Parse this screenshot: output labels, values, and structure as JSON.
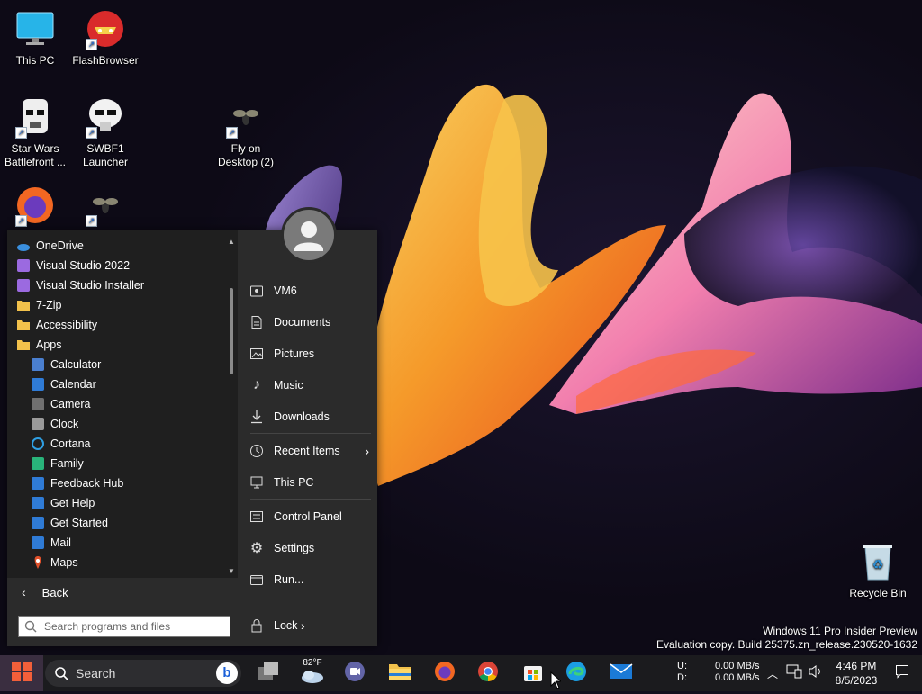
{
  "desktop": {
    "icons": [
      {
        "label": "This PC",
        "icon": "monitor-icon"
      },
      {
        "label": "FlashBrowser",
        "icon": "flash-icon"
      },
      {
        "label": "Star Wars Battlefront ...",
        "icon": "stormtrooper-icon"
      },
      {
        "label": "SWBF1 Launcher",
        "icon": "stormtrooper-icon"
      },
      {
        "label": "Fly on Desktop (2)",
        "icon": "fly-icon"
      },
      {
        "label": "Recycle Bin",
        "icon": "recycle-bin-icon"
      }
    ],
    "watermark": {
      "line1": "Windows 11 Pro Insider Preview",
      "line2": "Evaluation copy. Build 25375.zn_release.230520-1632"
    }
  },
  "start_menu": {
    "programs": [
      {
        "label": "OneDrive",
        "icon": "onedrive-icon",
        "indent": 0
      },
      {
        "label": "Visual Studio 2022",
        "icon": "visual-studio-icon",
        "indent": 0
      },
      {
        "label": "Visual Studio Installer",
        "icon": "visual-studio-icon",
        "indent": 0
      },
      {
        "label": "7-Zip",
        "icon": "folder-icon",
        "indent": 0
      },
      {
        "label": "Accessibility",
        "icon": "folder-icon",
        "indent": 0
      },
      {
        "label": "Apps",
        "icon": "folder-icon",
        "indent": 0
      },
      {
        "label": "Calculator",
        "icon": "calculator-icon",
        "indent": 1
      },
      {
        "label": "Calendar",
        "icon": "calendar-icon",
        "indent": 1
      },
      {
        "label": "Camera",
        "icon": "camera-icon",
        "indent": 1
      },
      {
        "label": "Clock",
        "icon": "clock-icon",
        "indent": 1
      },
      {
        "label": "Cortana",
        "icon": "cortana-icon",
        "indent": 1
      },
      {
        "label": "Family",
        "icon": "family-icon",
        "indent": 1
      },
      {
        "label": "Feedback Hub",
        "icon": "feedback-icon",
        "indent": 1
      },
      {
        "label": "Get Help",
        "icon": "help-icon",
        "indent": 1
      },
      {
        "label": "Get Started",
        "icon": "get-started-icon",
        "indent": 1
      },
      {
        "label": "Mail",
        "icon": "mail-icon",
        "indent": 1
      },
      {
        "label": "Maps",
        "icon": "maps-icon",
        "indent": 1
      }
    ],
    "back_label": "Back",
    "search_placeholder": "Search programs and files",
    "places": {
      "user": "VM6",
      "documents": "Documents",
      "pictures": "Pictures",
      "music": "Music",
      "downloads": "Downloads",
      "recent": "Recent Items",
      "this_pc": "This PC",
      "control_panel": "Control Panel",
      "settings": "Settings",
      "run": "Run..."
    },
    "lock_label": "Lock"
  },
  "taskbar": {
    "search_label": "Search",
    "weather_temp": "82°F",
    "net_up_label": "U:",
    "net_down_label": "D:",
    "net_up": "0.00 MB/s",
    "net_down": "0.00 MB/s",
    "time": "4:46 PM",
    "date": "8/5/2023",
    "apps": [
      "task-view-icon",
      "weather-icon",
      "teams-icon",
      "file-explorer-icon",
      "firefox-icon",
      "chrome-icon",
      "store-icon",
      "edge-icon",
      "mail-icon"
    ]
  },
  "colors": {
    "start_bg": "#2b2b2b",
    "programs_bg": "#1f1f1f",
    "taskbar_bg": "#1b1b1e",
    "accent": "#0078d4"
  }
}
